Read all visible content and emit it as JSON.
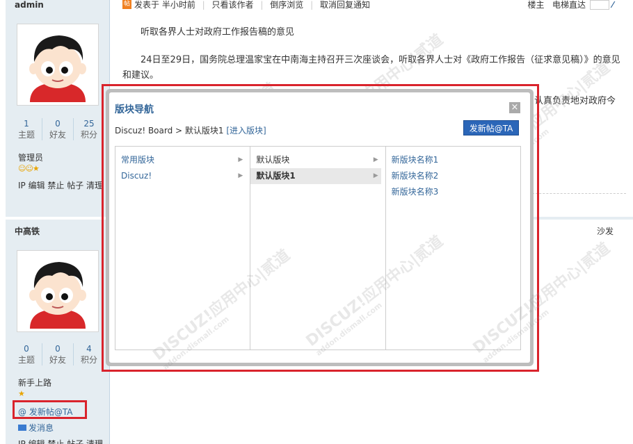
{
  "user1": {
    "name": "admin",
    "stats": [
      {
        "num": "1",
        "label": "主题"
      },
      {
        "num": "0",
        "label": "好友"
      },
      {
        "num": "25",
        "label": "积分"
      }
    ],
    "role": "管理员",
    "actions": "IP 编辑 禁止 帖子 清理"
  },
  "user2": {
    "name": "中高铁",
    "stats": [
      {
        "num": "0",
        "label": "主题"
      },
      {
        "num": "0",
        "label": "好友"
      },
      {
        "num": "4",
        "label": "积分"
      }
    ],
    "role": "新手上路",
    "at_link": "@ 发新帖@TA",
    "msg_link": "发消息",
    "actions": "IP 编辑 禁止 帖子 清理"
  },
  "topbar": {
    "posted": "发表于 半小时前",
    "author_only": "只看该作者",
    "reverse": "倒序浏览",
    "cancel_notify": "取消回复通知",
    "floor": "楼主",
    "jump": "电梯直达"
  },
  "content": {
    "title": "听取各界人士对政府工作报告稿的意见",
    "para": "24日至29日，国务院总理温家宝在中南海主持召开三次座谈会，听取各界人士对《政府工作报告（征求意见稿）》的意见和建议。",
    "right_fragment": "认真负责地对政府今"
  },
  "sofa": "沙发",
  "modal": {
    "title": "版块导航",
    "close": "×",
    "breadcrumb_prefix": "Discuz! Board > 默认版块1",
    "breadcrumb_link": "[进入版块]",
    "post_button": "发新帖@TA",
    "col1": [
      "常用版块",
      "Discuz!"
    ],
    "col2": [
      "默认版块",
      "默认版块1"
    ],
    "col3": [
      "新版块名称1",
      "新版块名称2",
      "新版块名称3"
    ]
  },
  "watermark": {
    "main": "DISCUZ!应用中心|贰道",
    "sub": "addon.dismall.com"
  },
  "colors": {
    "accent": "#369",
    "highlight_red": "#d9232c",
    "button_blue": "#2b66b8",
    "sidebar_bg": "#e5edf2"
  }
}
